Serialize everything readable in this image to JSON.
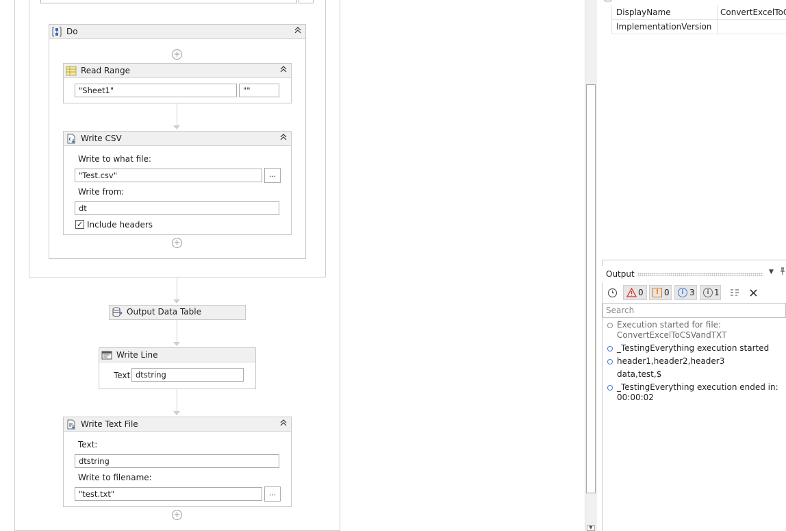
{
  "designer": {
    "do_sequence": {
      "title": "Do"
    },
    "read_range": {
      "title": "Read Range",
      "sheet_value": "\"Sheet1\"",
      "range_value": "\"\""
    },
    "write_csv": {
      "title": "Write CSV",
      "file_label": "Write to what file:",
      "file_value": "\"Test.csv\"",
      "browse_label": "...",
      "from_label": "Write from:",
      "from_value": "dt",
      "include_headers_label": "Include headers",
      "include_headers_checked": true,
      "checkmark": "✓"
    },
    "output_data_table": {
      "title": "Output Data Table"
    },
    "write_line": {
      "title": "Write Line",
      "text_label": "Text",
      "text_value": "dtstring"
    },
    "write_text_file": {
      "title": "Write Text File",
      "text_label": "Text:",
      "text_value": "dtstring",
      "filename_label": "Write to filename:",
      "filename_value": "\"test.txt\"",
      "browse_label": "..."
    }
  },
  "properties": {
    "rows": [
      {
        "name": "DisplayName",
        "value": "ConvertExcelToCSVandTXT"
      },
      {
        "name": "ImplementationVersion",
        "value": ""
      }
    ]
  },
  "output_panel": {
    "title": "Output",
    "toolbar": {
      "errors_count": "0",
      "warnings_count": "0",
      "info_count": "3",
      "trace_count": "1"
    },
    "search_placeholder": "Search",
    "log_lines": [
      {
        "line1": "Execution started for file:",
        "line2": "ConvertExcelToCSVandTXT"
      },
      {
        "line1": "_TestingEverything execution started"
      },
      {
        "line1": "header1,header2,header3",
        "line2": "data,test,$"
      },
      {
        "line1": "_TestingEverything execution ended in:",
        "line2": "00:00:02"
      }
    ]
  },
  "colors": {
    "accent_blue": "#3c78d8",
    "error_red": "#d93025",
    "warning_orange": "#e8710a"
  }
}
